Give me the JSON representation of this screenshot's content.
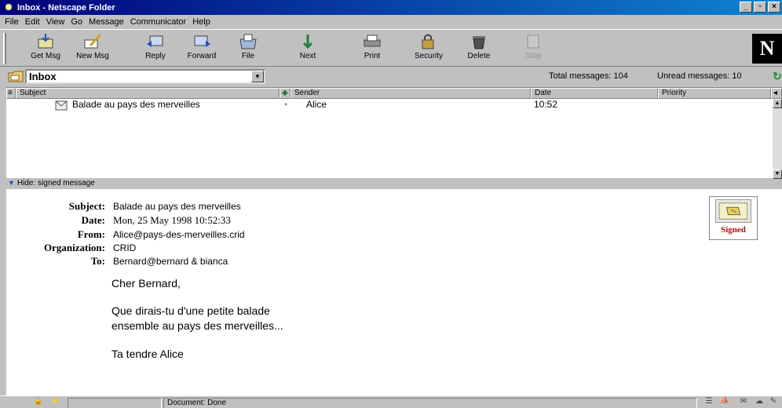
{
  "window": {
    "title": "Inbox - Netscape Folder",
    "controls": [
      "_",
      "▫",
      "×"
    ]
  },
  "menubar": [
    {
      "label": "File"
    },
    {
      "label": "Edit"
    },
    {
      "label": "View"
    },
    {
      "label": "Go"
    },
    {
      "label": "Message"
    },
    {
      "label": "Communicator"
    },
    {
      "label": "Help"
    }
  ],
  "toolbar": {
    "get_msg": "Get Msg",
    "new_msg": "New Msg",
    "reply": "Reply",
    "forward": "Forward",
    "file": "File",
    "next": "Next",
    "print": "Print",
    "security": "Security",
    "delete": "Delete",
    "stop": "Stop",
    "logo": "N"
  },
  "location": {
    "folder": "Inbox",
    "total_label": "Total messages: 104",
    "unread_label": "Unread messages: 10"
  },
  "columns": {
    "subject": "Subject",
    "sender": "Sender",
    "date": "Date",
    "priority": "Priority"
  },
  "messages": [
    {
      "subject": "Balade au pays des merveilles",
      "sender": "Alice",
      "date": "10:52"
    }
  ],
  "divider": {
    "label": "Hide: signed message"
  },
  "message": {
    "labels": {
      "subject": "Subject:",
      "date": "Date:",
      "from": "From:",
      "organization": "Organization:",
      "to": "To:"
    },
    "subject": "Balade au pays des merveilles",
    "date": "Mon, 25 May 1998 10:52:33",
    "from": "Alice@pays-des-merveilles.crid",
    "organization": "CRID",
    "to": "Bernard@bernard & bianca",
    "body": [
      "Cher Bernard,",
      "Que dirais-tu d'une petite balade",
      "ensemble au pays des merveilles...",
      "Ta tendre Alice"
    ],
    "signed_label": "Signed"
  },
  "statusbar": {
    "text": "Document: Done"
  }
}
